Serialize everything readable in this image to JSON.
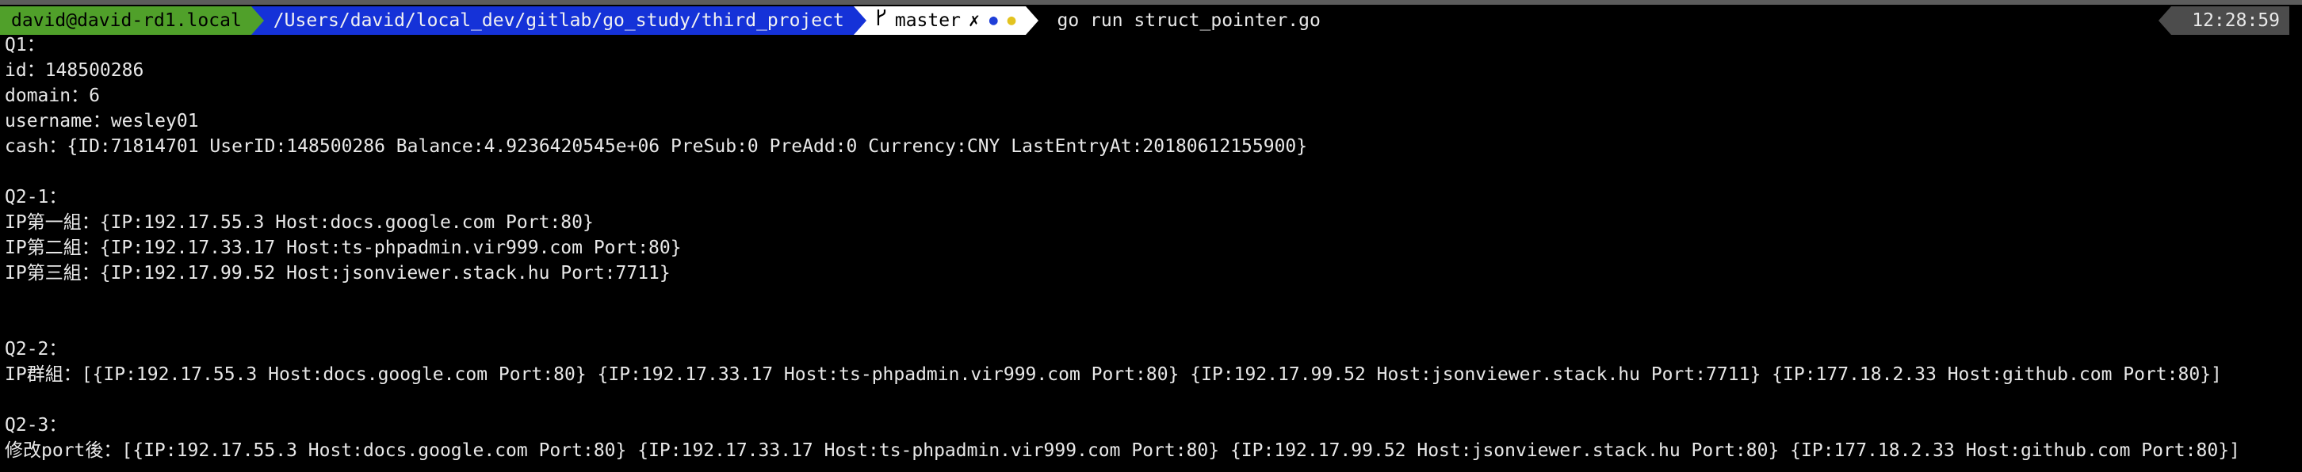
{
  "prompt": {
    "host": "david@david-rd1.local",
    "path": "/Users/david/local_dev/gitlab/go_study/third_project",
    "branch_icon": "git-branch-icon",
    "branch": "master",
    "git_status_mark": "✗",
    "status_dot_1": "●",
    "status_dot_2": "●",
    "command": "go run struct_pointer.go",
    "time": "12:28:59",
    "colors": {
      "host_bg": "#50a02a",
      "path_bg": "#1532d8",
      "git_bg": "#ffffff",
      "time_bg": "#4c4c4c"
    }
  },
  "output": {
    "lines": [
      "Q1：",
      "id：148500286",
      "domain：6",
      "username：wesley01",
      "cash：{ID:71814701 UserID:148500286 Balance:4.9236420545e+06 PreSub:0 PreAdd:0 Currency:CNY LastEntryAt:20180612155900}",
      "",
      "Q2-1：",
      "IP第一組：{IP:192.17.55.3 Host:docs.google.com Port:80}",
      "IP第二組：{IP:192.17.33.17 Host:ts-phpadmin.vir999.com Port:80}",
      "IP第三組：{IP:192.17.99.52 Host:jsonviewer.stack.hu Port:7711}",
      "",
      "",
      "Q2-2：",
      "IP群組：[{IP:192.17.55.3 Host:docs.google.com Port:80} {IP:192.17.33.17 Host:ts-phpadmin.vir999.com Port:80} {IP:192.17.99.52 Host:jsonviewer.stack.hu Port:7711} {IP:177.18.2.33 Host:github.com Port:80}]",
      "",
      "Q2-3：",
      "修改port後：[{IP:192.17.55.3 Host:docs.google.com Port:80} {IP:192.17.33.17 Host:ts-phpadmin.vir999.com Port:80} {IP:192.17.99.52 Host:jsonviewer.stack.hu Port:80} {IP:177.18.2.33 Host:github.com Port:80}]"
    ]
  }
}
